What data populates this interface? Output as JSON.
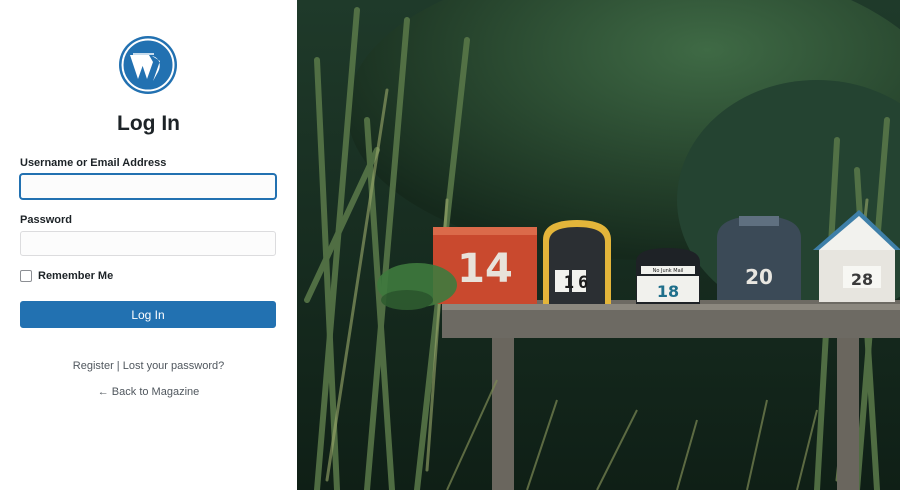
{
  "login": {
    "title": "Log In",
    "username_label": "Username or Email Address",
    "username_value": "",
    "password_label": "Password",
    "password_value": "",
    "remember_label": "Remember Me",
    "remember_checked": false,
    "submit_label": "Log In",
    "register_link": "Register",
    "separator": "|",
    "lost_password_link": "Lost your password?",
    "back_link": "← Back to Magazine"
  },
  "photo": {
    "mailbox_numbers": [
      "14",
      "16",
      "18",
      "20",
      "28"
    ],
    "small_label": "No Junk Mail"
  },
  "colors": {
    "accent": "#2271b1",
    "logo": "#2271b1",
    "text": "#1d2327",
    "muted": "#50575e"
  }
}
